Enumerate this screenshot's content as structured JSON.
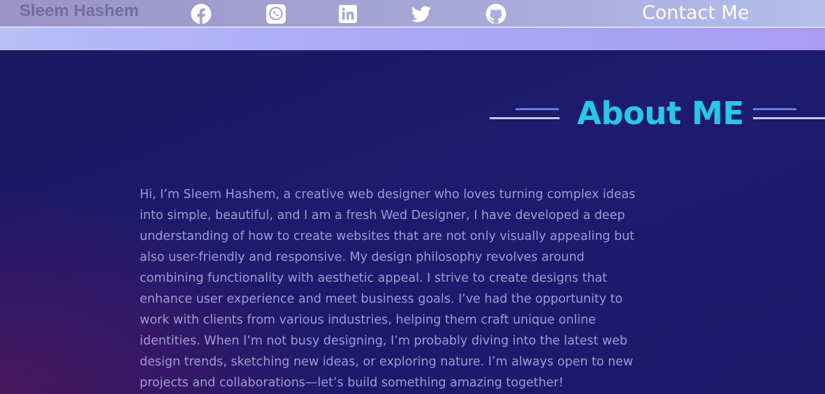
{
  "header": {
    "brand": "Sleem Hashem",
    "social_icons": [
      "facebook-icon",
      "whatsapp-icon",
      "linkedin-icon",
      "twitter-icon",
      "github-icon"
    ],
    "contact_label": "Contact Me"
  },
  "about": {
    "title": "About ME",
    "text": "Hi, I’m Sleem Hashem, a creative web designer who loves turning complex ideas into simple, beautiful, and I am a fresh Wed Designer, I have developed a deep understanding of how to create websites that are not only visually appealing but also user-friendly and responsive. My design philosophy revolves around combining functionality with aesthetic appeal. I strive to create designs that enhance user experience and meet business goals. I’ve had the opportunity to work with clients from various industries, helping them craft unique online identities. When I’m not busy designing, I’m probably diving into the latest web design trends, sketching new ideas, or exploring nature. I’m always open to new projects and collaborations—let’s build something amazing together!"
  },
  "colors": {
    "accent": "#22c9ea",
    "body_text": "#a09bd2",
    "background": "#1c1a63",
    "nav_text": "#6e6f93"
  }
}
